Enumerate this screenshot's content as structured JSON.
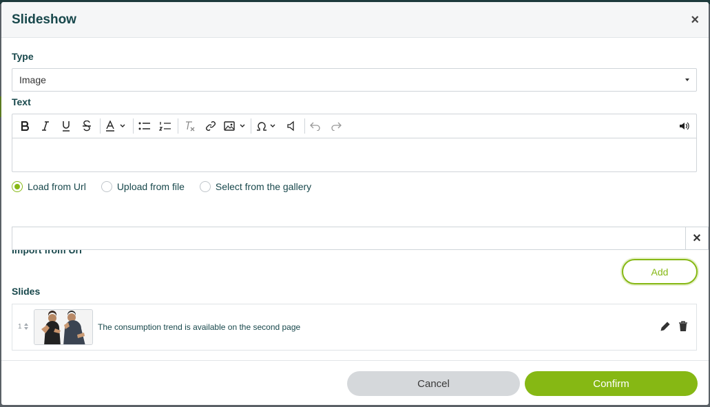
{
  "dialog": {
    "title": "Slideshow",
    "close_glyph": "×"
  },
  "type_field": {
    "label": "Type",
    "selected": "Image"
  },
  "text_field": {
    "label": "Text",
    "toolbar": [
      "bold-icon",
      "italic-icon",
      "underline-icon",
      "strikethrough-icon",
      "font-color-icon",
      "bulleted-list-icon",
      "numbered-list-icon",
      "remove-format-icon",
      "link-icon",
      "image-icon",
      "special-character-icon",
      "audio-icon",
      "undo-icon",
      "redo-icon",
      "speaker-icon"
    ],
    "value": ""
  },
  "source_options": [
    {
      "label": "Load from Url",
      "checked": true
    },
    {
      "label": "Upload from file",
      "checked": false
    },
    {
      "label": "Select from the gallery",
      "checked": false
    }
  ],
  "import_url": {
    "label": "Import from Url",
    "value": "",
    "clear_glyph": "✕"
  },
  "add_button": "Add",
  "slides": {
    "label": "Slides",
    "items": [
      {
        "index": "1",
        "caption": "The consumption trend is available on the second page"
      }
    ]
  },
  "footer": {
    "cancel": "Cancel",
    "confirm": "Confirm"
  },
  "colors": {
    "accent": "#86b814",
    "heading": "#17474b"
  }
}
